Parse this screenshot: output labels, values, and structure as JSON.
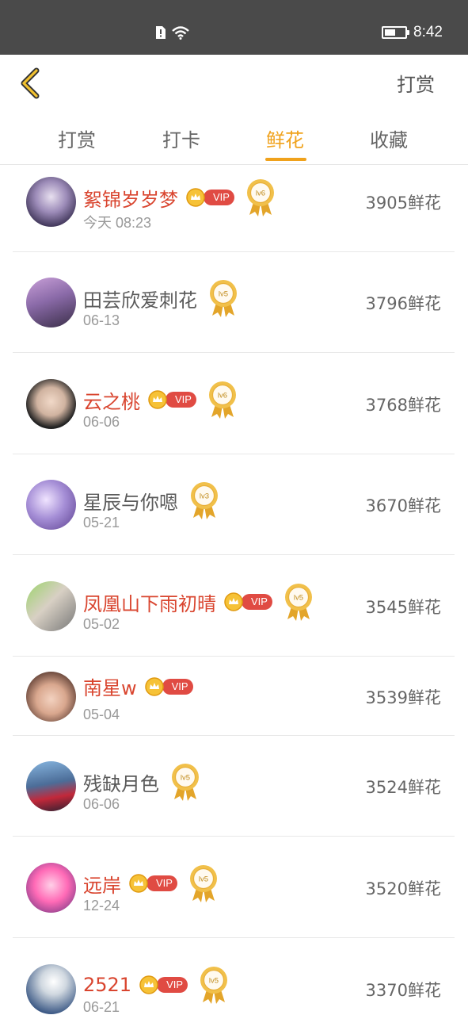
{
  "status_bar": {
    "time": "8:42",
    "icons": [
      "sim-alert-icon",
      "wifi-icon",
      "battery-icon"
    ],
    "battery_level": 0.55
  },
  "header": {
    "back_icon": "chevron-left-icon",
    "action_label": "打赏"
  },
  "tabs": [
    {
      "label": "打赏",
      "active": false
    },
    {
      "label": "打卡",
      "active": false
    },
    {
      "label": "鲜花",
      "active": true
    },
    {
      "label": "收藏",
      "active": false
    }
  ],
  "colors": {
    "accent": "#f0a21c",
    "vip_name": "#d9452f",
    "vip_badge": "#e04b43",
    "status_bar": "#4a4a4a"
  },
  "rows": [
    {
      "name": "絮锦岁岁梦",
      "vip": true,
      "vip_label": "VIP",
      "level": "lv6",
      "date": "今天 08:23",
      "count": "3905鲜花"
    },
    {
      "name": "田芸欣爱刺花",
      "vip": false,
      "vip_label": "",
      "level": "lv5",
      "date": "06-13",
      "count": "3796鲜花"
    },
    {
      "name": "云之桃",
      "vip": true,
      "vip_label": "VIP",
      "level": "lv6",
      "date": "06-06",
      "count": "3768鲜花"
    },
    {
      "name": "星辰与你嗯",
      "vip": false,
      "vip_label": "",
      "level": "lv3",
      "date": "05-21",
      "count": "3670鲜花"
    },
    {
      "name": "凤凰山下雨初晴",
      "vip": true,
      "vip_label": "VIP",
      "level": "lv5",
      "date": "05-02",
      "count": "3545鲜花"
    },
    {
      "name": "南星w",
      "vip": true,
      "vip_label": "VIP",
      "level": "",
      "date": "05-04",
      "count": "3539鲜花"
    },
    {
      "name": "残缺月色",
      "vip": false,
      "vip_label": "",
      "level": "lv5",
      "date": "06-06",
      "count": "3524鲜花"
    },
    {
      "name": "远岸",
      "vip": true,
      "vip_label": "VIP",
      "level": "lv5",
      "date": "12-24",
      "count": "3520鲜花"
    },
    {
      "name": "2521",
      "vip": true,
      "vip_label": "VIP",
      "level": "lv5",
      "date": "06-21",
      "count": "3370鲜花"
    }
  ]
}
